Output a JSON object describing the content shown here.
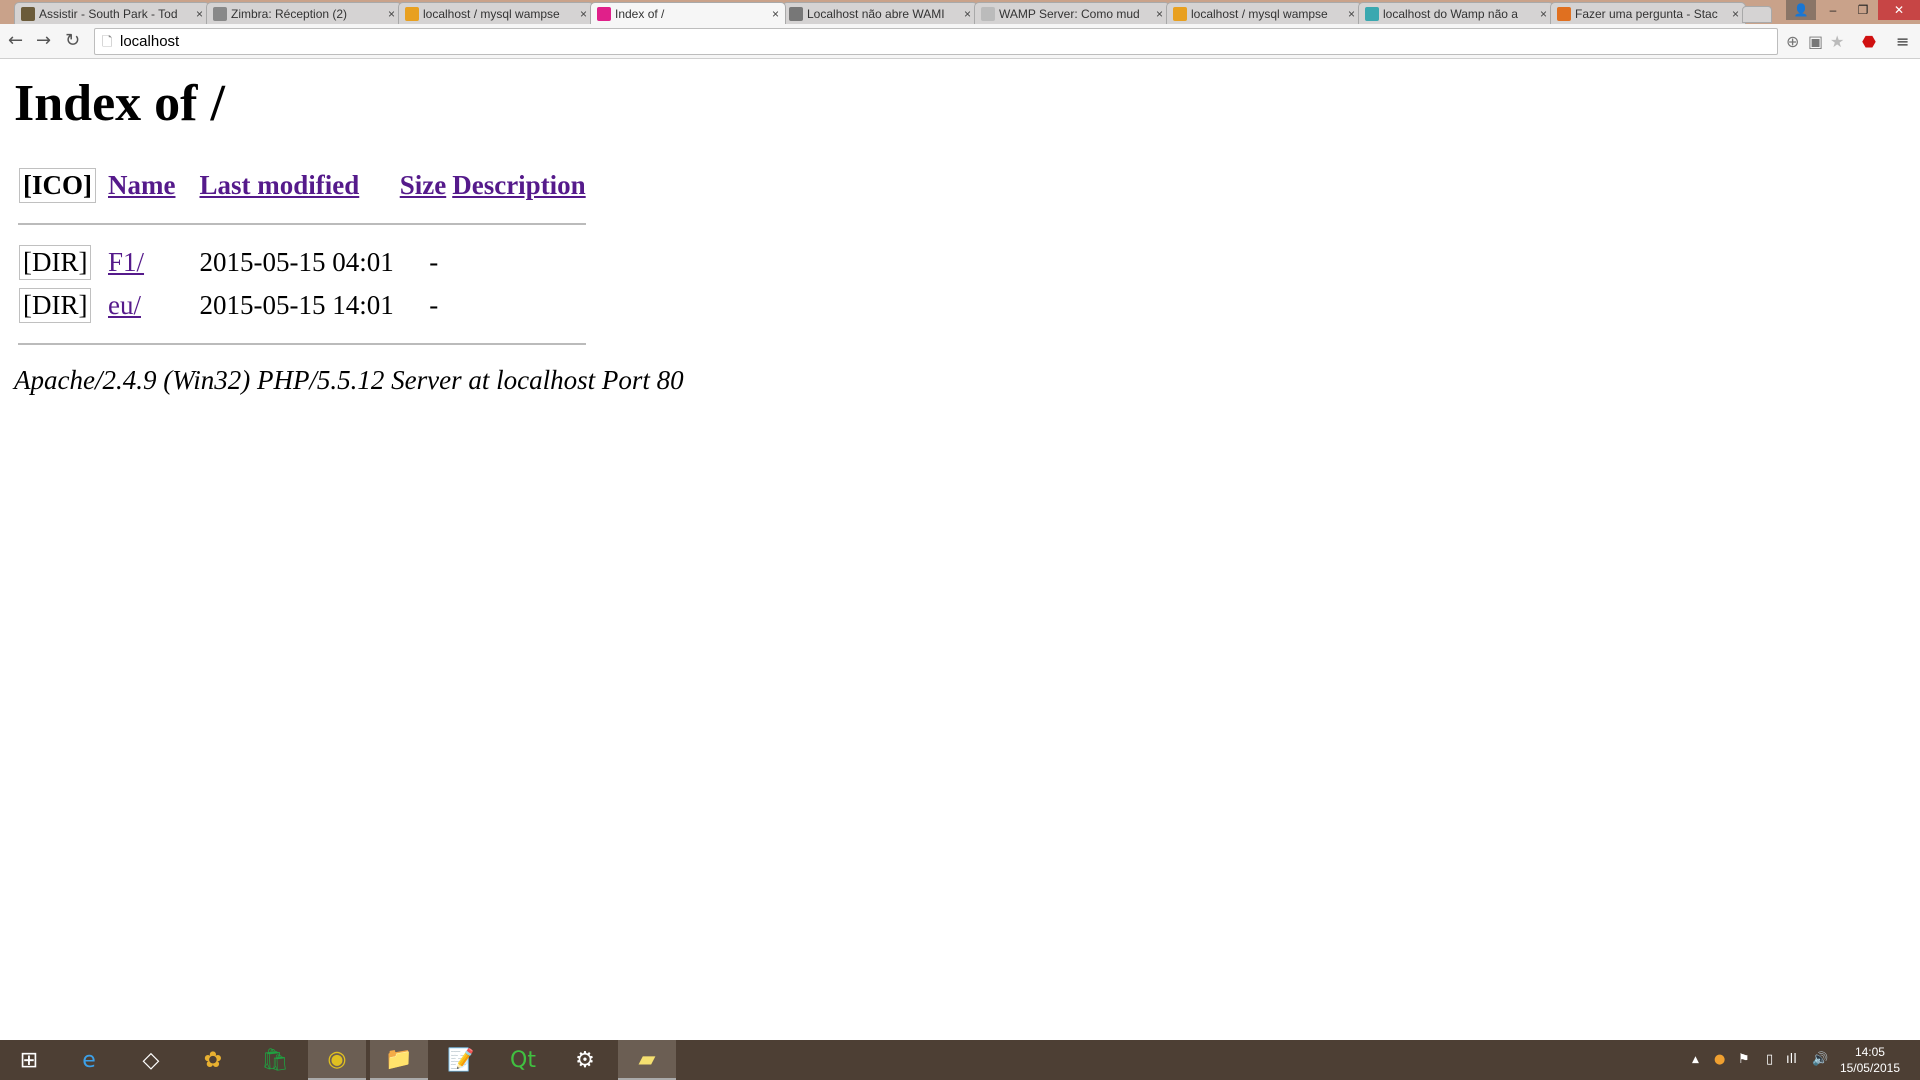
{
  "browser": {
    "tabs": [
      {
        "title": "Assistir - South Park - Tod",
        "icon": "tv-icon",
        "color": "#6b5b3a"
      },
      {
        "title": "Zimbra: Réception (2)",
        "icon": "zimbra-icon",
        "color": "#888888"
      },
      {
        "title": "localhost / mysql wampse",
        "icon": "phpmyadmin-icon",
        "color": "#e8a020"
      },
      {
        "title": "Index of /",
        "icon": "wamp-icon",
        "color": "#e0208a",
        "active": true
      },
      {
        "title": "Localhost não abre WAMI",
        "icon": "tn-icon",
        "color": "#777777"
      },
      {
        "title": "WAMP Server: Como mud",
        "icon": "page-icon",
        "color": "#bbbbbb"
      },
      {
        "title": "localhost / mysql wampse",
        "icon": "phpmyadmin-icon",
        "color": "#e8a020"
      },
      {
        "title": "localhost do Wamp não a",
        "icon": "puzzle-icon",
        "color": "#3aa8b0"
      },
      {
        "title": "Fazer uma pergunta - Stac",
        "icon": "stackoverflow-icon",
        "color": "#e07020"
      }
    ],
    "close_glyph": "×",
    "url": "localhost"
  },
  "page": {
    "title": "Index of /",
    "headers": {
      "ico": "[ICO]",
      "name": "Name",
      "modified": "Last modified",
      "size": "Size",
      "description": "Description"
    },
    "rows": [
      {
        "alt": "[DIR]",
        "name": "F1/",
        "modified": "2015-05-15 04:01",
        "size": "-",
        "description": ""
      },
      {
        "alt": "[DIR]",
        "name": "eu/",
        "modified": "2015-05-15 14:01",
        "size": "-",
        "description": ""
      }
    ],
    "address": "Apache/2.4.9 (Win32) PHP/5.5.12 Server at localhost Port 80"
  },
  "taskbar": {
    "apps": [
      "start-icon",
      "internet-explorer-icon",
      "dropbox-icon",
      "picasa-icon",
      "store-icon",
      "chrome-icon",
      "file-explorer-icon",
      "notepad-icon",
      "qt-icon",
      "steam-icon",
      "sticky-notes-icon"
    ],
    "time": "14:05",
    "date": "15/05/2015"
  }
}
